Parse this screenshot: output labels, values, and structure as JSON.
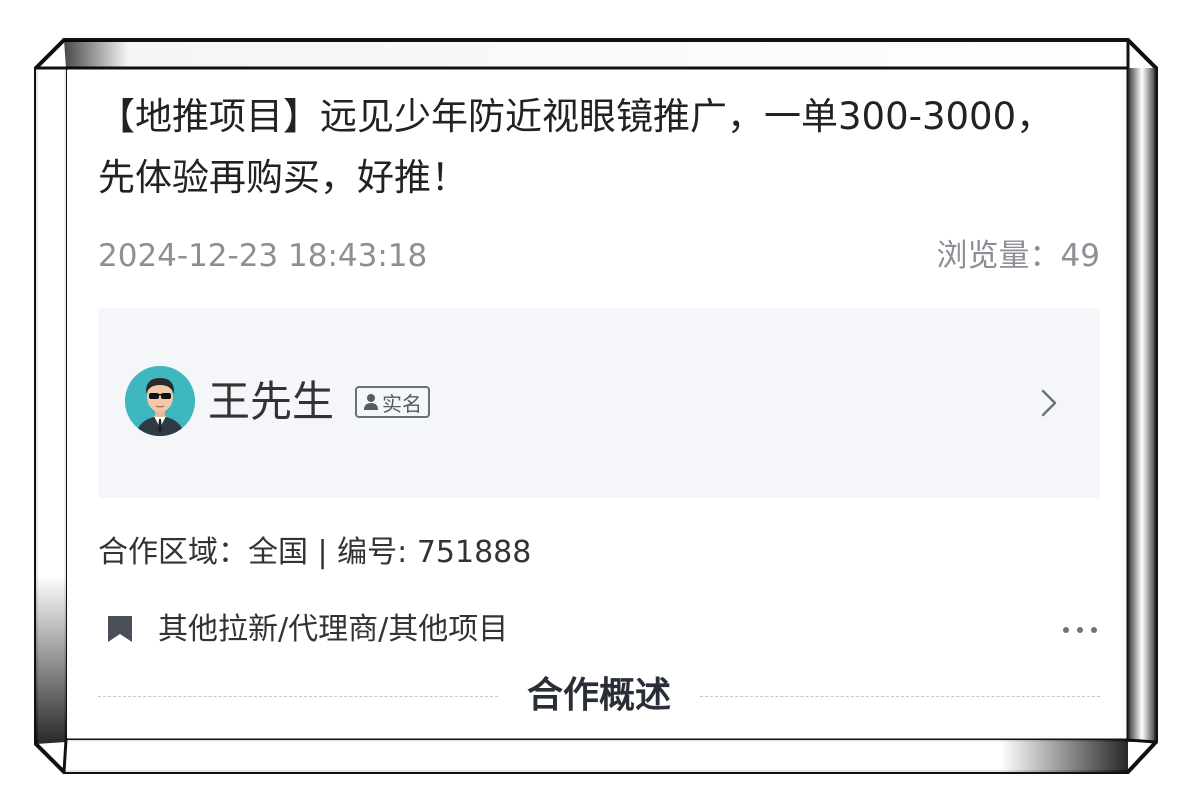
{
  "post": {
    "title": "【地推项目】远见少年防近视眼镜推广，一单300-3000，先体验再购买，好推！",
    "date": "2024-12-23 18:43:18",
    "views_label": "浏览量：49"
  },
  "author": {
    "name": "王先生",
    "verify_label": "实名"
  },
  "info": {
    "region_and_id": "合作区域：全国 | 编号: 751888"
  },
  "category": {
    "path": "其他拉新/代理商/其他项目"
  },
  "section": {
    "title": "合作概述"
  },
  "icons": {
    "avatar": "avatar-man-sunglasses",
    "verify": "person-icon",
    "arrow": "chevron-right-icon",
    "bookmark": "bookmark-icon",
    "more": "more-dots-icon"
  },
  "colors": {
    "text_primary": "#222222",
    "text_muted": "#8c8f96",
    "panel_bg": "#f5f6f9",
    "avatar_bg": "#3fb7bf"
  }
}
